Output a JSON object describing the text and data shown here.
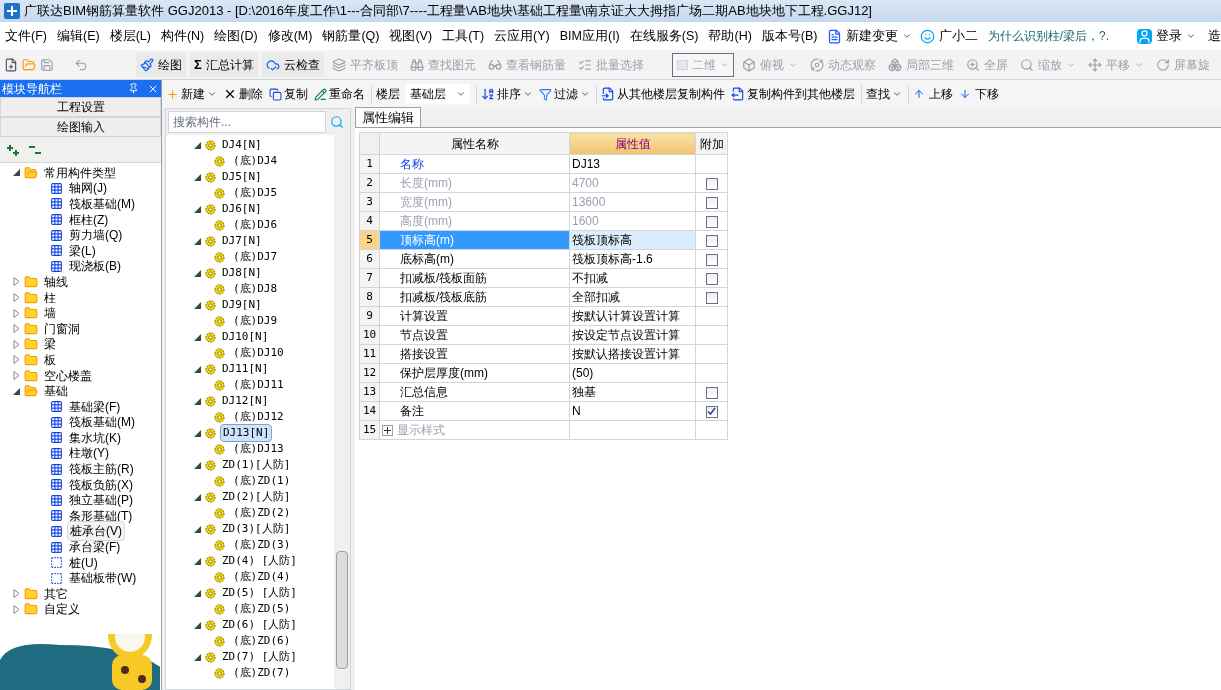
{
  "window": {
    "title": "广联达BIM钢筋算量软件 GGJ2013 - [D:\\2016年度工作\\1---合同部\\7----工程量\\AB地块\\基础工程量\\南京证大大拇指广场二期AB地块地下工程.GGJ12]"
  },
  "menu": {
    "items": [
      "文件(F)",
      "编辑(E)",
      "楼层(L)",
      "构件(N)",
      "绘图(D)",
      "修改(M)",
      "钢筋量(Q)",
      "视图(V)",
      "工具(T)",
      "云应用(Y)",
      "BIM应用(I)",
      "在线服务(S)",
      "帮助(H)",
      "版本号(B)"
    ],
    "new_change": "新建变更",
    "assistant": "广小二",
    "tip": "为什么识别柱/梁后，?.",
    "login": "登录",
    "cut_item": "造"
  },
  "toolbar": {
    "items": [
      {
        "label": "绘图",
        "disabled": false,
        "dropdown": false
      },
      {
        "label": "汇总计算",
        "glyph": "Σ",
        "disabled": false,
        "dropdown": false
      },
      {
        "label": "云检查",
        "disabled": false,
        "dropdown": false
      },
      {
        "label": "平齐板顶",
        "disabled": true,
        "dropdown": false
      },
      {
        "label": "查找图元",
        "disabled": true,
        "dropdown": false
      },
      {
        "label": "查看钢筋量",
        "disabled": true,
        "dropdown": false
      },
      {
        "label": "批量选择",
        "disabled": true,
        "dropdown": false
      }
    ],
    "view_select": "二维",
    "view_items": [
      {
        "label": "俯视",
        "disabled": true,
        "dropdown": true
      },
      {
        "label": "动态观察",
        "disabled": true,
        "dropdown": false
      },
      {
        "label": "局部三维",
        "disabled": true,
        "dropdown": false
      },
      {
        "label": "全屏",
        "disabled": true,
        "dropdown": false
      },
      {
        "label": "缩放",
        "disabled": true,
        "dropdown": true
      },
      {
        "label": "平移",
        "disabled": true,
        "dropdown": true
      },
      {
        "label": "屏幕旋",
        "disabled": true,
        "dropdown": false
      }
    ]
  },
  "nav_panel": {
    "title": "模块导航栏",
    "buttons": [
      "工程设置",
      "绘图输入"
    ],
    "tree": [
      {
        "label": "常用构件类型",
        "kind": "folder",
        "expanded": true,
        "selected": false,
        "children": [
          {
            "label": "轴网(J)",
            "kind": "component",
            "selected": false
          },
          {
            "label": "筏板基础(M)",
            "kind": "component",
            "selected": false
          },
          {
            "label": "框柱(Z)",
            "kind": "component",
            "selected": false
          },
          {
            "label": "剪力墙(Q)",
            "kind": "component",
            "selected": false
          },
          {
            "label": "梁(L)",
            "kind": "component",
            "selected": false
          },
          {
            "label": "现浇板(B)",
            "kind": "component",
            "selected": false
          }
        ]
      },
      {
        "label": "轴线",
        "kind": "folder",
        "expanded": false,
        "selected": false
      },
      {
        "label": "柱",
        "kind": "folder",
        "expanded": false,
        "selected": false
      },
      {
        "label": "墙",
        "kind": "folder",
        "expanded": false,
        "selected": false
      },
      {
        "label": "门窗洞",
        "kind": "folder",
        "expanded": false,
        "selected": false
      },
      {
        "label": "梁",
        "kind": "folder",
        "expanded": false,
        "selected": false
      },
      {
        "label": "板",
        "kind": "folder",
        "expanded": false,
        "selected": false
      },
      {
        "label": "空心楼盖",
        "kind": "folder",
        "expanded": false,
        "selected": false
      },
      {
        "label": "基础",
        "kind": "folder",
        "expanded": true,
        "selected": false,
        "children": [
          {
            "label": "基础梁(F)",
            "kind": "component",
            "selected": false
          },
          {
            "label": "筏板基础(M)",
            "kind": "component",
            "selected": false
          },
          {
            "label": "集水坑(K)",
            "kind": "component",
            "selected": false
          },
          {
            "label": "柱墩(Y)",
            "kind": "component",
            "selected": false
          },
          {
            "label": "筏板主筋(R)",
            "kind": "component",
            "selected": false
          },
          {
            "label": "筏板负筋(X)",
            "kind": "component",
            "selected": false
          },
          {
            "label": "独立基础(P)",
            "kind": "component",
            "selected": false
          },
          {
            "label": "条形基础(T)",
            "kind": "component",
            "selected": false
          },
          {
            "label": "桩承台(V)",
            "kind": "component",
            "selected": true
          },
          {
            "label": "承台梁(F)",
            "kind": "component",
            "selected": false
          },
          {
            "label": "桩(U)",
            "kind": "component",
            "selected": false
          },
          {
            "label": "基础板带(W)",
            "kind": "component",
            "selected": false
          }
        ]
      },
      {
        "label": "其它",
        "kind": "folder",
        "expanded": false,
        "selected": false
      },
      {
        "label": "自定义",
        "kind": "folder",
        "expanded": false,
        "selected": false
      }
    ]
  },
  "component_panel": {
    "search": {
      "placeholder": "搜索构件..."
    },
    "items": [
      {
        "label": "DJ4[N]",
        "selected": false,
        "expanded": true,
        "children": [
          {
            "label": "(底)DJ4",
            "selected": false
          }
        ]
      },
      {
        "label": "DJ5[N]",
        "selected": false,
        "expanded": true,
        "children": [
          {
            "label": "(底)DJ5",
            "selected": false
          }
        ]
      },
      {
        "label": "DJ6[N]",
        "selected": false,
        "expanded": true,
        "children": [
          {
            "label": "(底)DJ6",
            "selected": false
          }
        ]
      },
      {
        "label": "DJ7[N]",
        "selected": false,
        "expanded": true,
        "children": [
          {
            "label": "(底)DJ7",
            "selected": false
          }
        ]
      },
      {
        "label": "DJ8[N]",
        "selected": false,
        "expanded": true,
        "children": [
          {
            "label": "(底)DJ8",
            "selected": false
          }
        ]
      },
      {
        "label": "DJ9[N]",
        "selected": false,
        "expanded": true,
        "children": [
          {
            "label": "(底)DJ9",
            "selected": false
          }
        ]
      },
      {
        "label": "DJ10[N]",
        "selected": false,
        "expanded": true,
        "children": [
          {
            "label": "(底)DJ10",
            "selected": false
          }
        ]
      },
      {
        "label": "DJ11[N]",
        "selected": false,
        "expanded": true,
        "children": [
          {
            "label": "(底)DJ11",
            "selected": false
          }
        ]
      },
      {
        "label": "DJ12[N]",
        "selected": false,
        "expanded": true,
        "children": [
          {
            "label": "(底)DJ12",
            "selected": false
          }
        ]
      },
      {
        "label": "DJ13[N]",
        "selected": true,
        "expanded": true,
        "children": [
          {
            "label": "(底)DJ13",
            "selected": false
          }
        ]
      },
      {
        "label": "ZD(1)[人防]",
        "selected": false,
        "expanded": true,
        "children": [
          {
            "label": "(底)ZD(1)",
            "selected": false
          }
        ]
      },
      {
        "label": "ZD(2)[人防]",
        "selected": false,
        "expanded": true,
        "children": [
          {
            "label": "(底)ZD(2)",
            "selected": false
          }
        ]
      },
      {
        "label": "ZD(3)[人防]",
        "selected": false,
        "expanded": true,
        "children": [
          {
            "label": "(底)ZD(3)",
            "selected": false
          }
        ]
      },
      {
        "label": "ZD(4) [人防]",
        "selected": false,
        "expanded": true,
        "children": [
          {
            "label": "(底)ZD(4)",
            "selected": false
          }
        ]
      },
      {
        "label": "ZD(5) [人防]",
        "selected": false,
        "expanded": true,
        "children": [
          {
            "label": "(底)ZD(5)",
            "selected": false
          }
        ]
      },
      {
        "label": "ZD(6) [人防]",
        "selected": false,
        "expanded": true,
        "children": [
          {
            "label": "(底)ZD(6)",
            "selected": false
          }
        ]
      },
      {
        "label": "ZD(7) [人防]",
        "selected": false,
        "expanded": true,
        "children": [
          {
            "label": "(底)ZD(7)",
            "selected": false
          }
        ]
      }
    ]
  },
  "component_toolbar": {
    "new": "新建",
    "delete": "删除",
    "copy": "复制",
    "rename": "重命名",
    "floor_label": "楼层",
    "floor": "基础层",
    "sort": "排序",
    "filter": "过滤",
    "copy_from": "从其他楼层复制构件",
    "copy_to": "复制构件到其他楼层",
    "find": "查找",
    "move_up": "上移",
    "move_down": "下移"
  },
  "properties": {
    "tab": "属性编辑",
    "columns": [
      "属性名称",
      "属性值",
      "附加"
    ],
    "rows": [
      {
        "num": "1",
        "name": "名称",
        "value": "DJ13",
        "kind": "primary",
        "selected": false
      },
      {
        "num": "2",
        "name": "长度(mm)",
        "value": "4700",
        "kind": "readonly",
        "selected": false,
        "checked": false
      },
      {
        "num": "3",
        "name": "宽度(mm)",
        "value": "13600",
        "kind": "readonly",
        "selected": false,
        "checked": false
      },
      {
        "num": "4",
        "name": "高度(mm)",
        "value": "1600",
        "kind": "readonly",
        "selected": false,
        "checked": false
      },
      {
        "num": "5",
        "name": "顶标高(m)",
        "value": "筏板顶标高",
        "kind": "normal",
        "selected": true,
        "checked": false
      },
      {
        "num": "6",
        "name": "底标高(m)",
        "value": "筏板顶标高-1.6",
        "kind": "normal",
        "selected": false,
        "checked": false
      },
      {
        "num": "7",
        "name": "扣减板/筏板面筋",
        "value": "不扣减",
        "kind": "normal",
        "selected": false,
        "checked": false
      },
      {
        "num": "8",
        "name": "扣减板/筏板底筋",
        "value": "全部扣减",
        "kind": "normal",
        "selected": false,
        "checked": false
      },
      {
        "num": "9",
        "name": "计算设置",
        "value": "按默认计算设置计算",
        "kind": "normal",
        "selected": false
      },
      {
        "num": "10",
        "name": "节点设置",
        "value": "按设定节点设置计算",
        "kind": "normal",
        "selected": false
      },
      {
        "num": "11",
        "name": "搭接设置",
        "value": "按默认搭接设置计算",
        "kind": "normal",
        "selected": false
      },
      {
        "num": "12",
        "name": "保护层厚度(mm)",
        "value": "(50)",
        "kind": "normal",
        "selected": false
      },
      {
        "num": "13",
        "name": "汇总信息",
        "value": "独基",
        "kind": "normal",
        "selected": false,
        "checked": false
      },
      {
        "num": "14",
        "name": "备注",
        "value": "N",
        "kind": "normal",
        "selected": false,
        "checked": true
      },
      {
        "num": "15",
        "name": "显示样式",
        "kind": "group",
        "selected": false,
        "expanded": false
      }
    ]
  }
}
